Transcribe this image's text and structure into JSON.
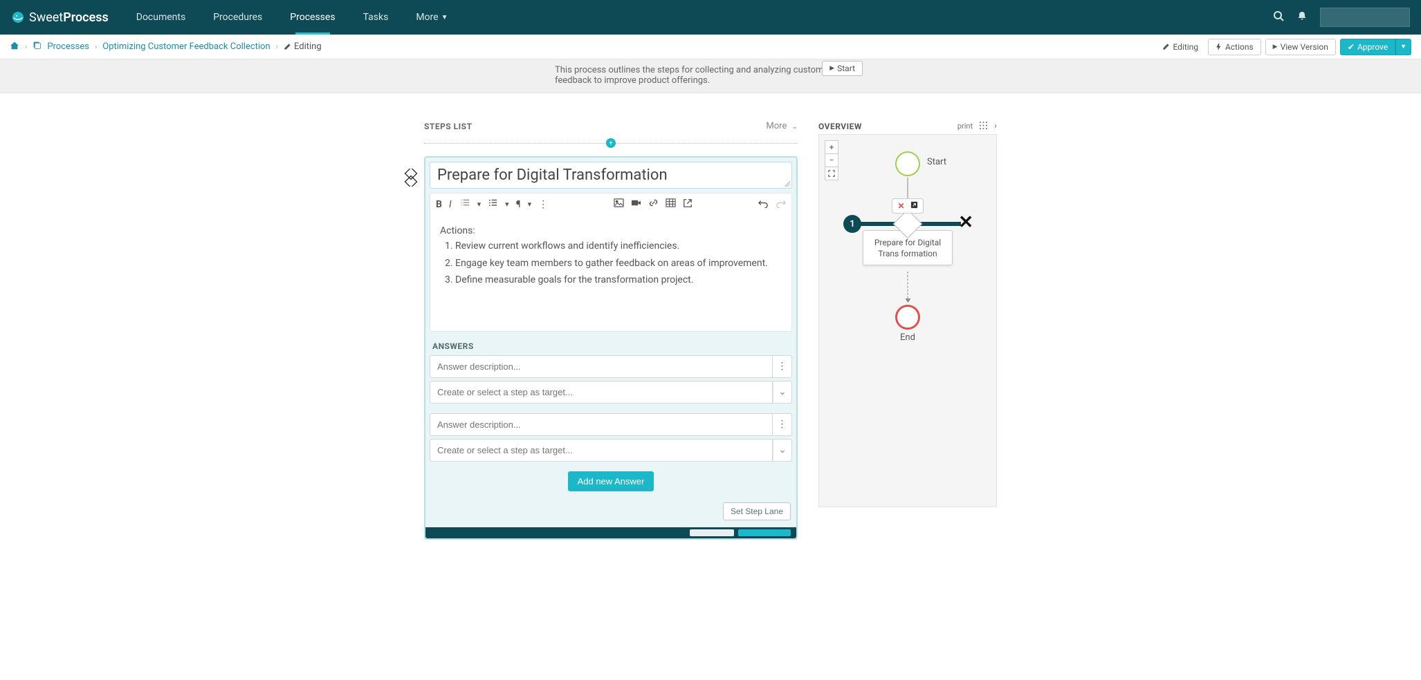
{
  "brand": {
    "name_a": "Sweet",
    "name_b": "Process"
  },
  "nav": {
    "documents": "Documents",
    "procedures": "Procedures",
    "processes": "Processes",
    "tasks": "Tasks",
    "more": "More"
  },
  "breadcrumb": {
    "processes": "Processes",
    "current": "Optimizing Customer Feedback Collection",
    "editing": "Editing"
  },
  "sub_actions": {
    "editing": "Editing",
    "actions": "Actions",
    "view_version": "View Version",
    "approve": "Approve"
  },
  "description": "This process outlines the steps for collecting and analyzing customer feedback to improve product offerings.",
  "start_btn": "Start",
  "steps_list_title": "STEPS LIST",
  "steps_list_more": "More",
  "step": {
    "title": "Prepare for Digital Transformation",
    "actions_label": "Actions:",
    "items": [
      "Review current workflows and identify inefficiencies.",
      "Engage key team members to gather feedback on areas of improvement.",
      "Define measurable goals for the transformation project."
    ]
  },
  "answers": {
    "title": "ANSWERS",
    "answer_placeholder": "Answer description...",
    "target_placeholder": "Create or select a step as target...",
    "add_btn": "Add new Answer",
    "lane_btn": "Set Step Lane"
  },
  "overview": {
    "title": "OVERVIEW",
    "print": "print",
    "start_label": "Start",
    "end_label": "End",
    "step_num": "1",
    "step_label": "Prepare for Digital Trans formation"
  }
}
